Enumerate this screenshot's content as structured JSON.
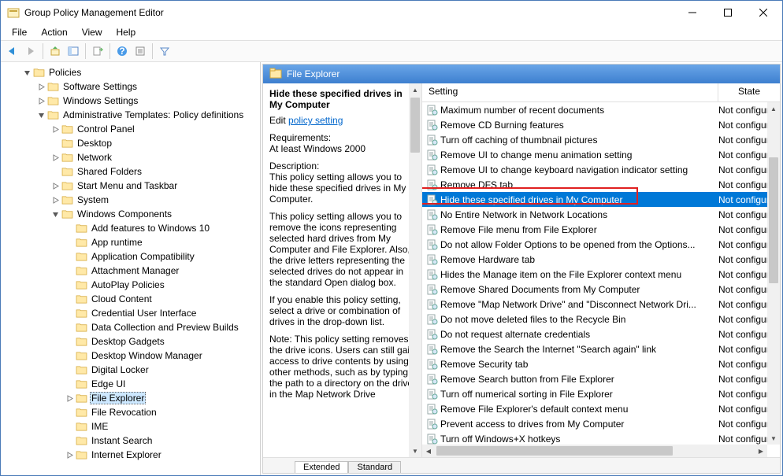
{
  "window": {
    "title": "Group Policy Management Editor"
  },
  "menus": [
    "File",
    "Action",
    "View",
    "Help"
  ],
  "tree": [
    {
      "indent": 1,
      "tw": "v",
      "label": "Policies"
    },
    {
      "indent": 2,
      "tw": ">",
      "label": "Software Settings"
    },
    {
      "indent": 2,
      "tw": ">",
      "label": "Windows Settings"
    },
    {
      "indent": 2,
      "tw": "v",
      "label": "Administrative Templates: Policy definitions"
    },
    {
      "indent": 3,
      "tw": ">",
      "label": "Control Panel"
    },
    {
      "indent": 3,
      "tw": "",
      "label": "Desktop"
    },
    {
      "indent": 3,
      "tw": ">",
      "label": "Network"
    },
    {
      "indent": 3,
      "tw": "",
      "label": "Shared Folders"
    },
    {
      "indent": 3,
      "tw": ">",
      "label": "Start Menu and Taskbar"
    },
    {
      "indent": 3,
      "tw": ">",
      "label": "System"
    },
    {
      "indent": 3,
      "tw": "v",
      "label": "Windows Components"
    },
    {
      "indent": 4,
      "tw": "",
      "label": "Add features to Windows 10"
    },
    {
      "indent": 4,
      "tw": "",
      "label": "App runtime"
    },
    {
      "indent": 4,
      "tw": "",
      "label": "Application Compatibility"
    },
    {
      "indent": 4,
      "tw": "",
      "label": "Attachment Manager"
    },
    {
      "indent": 4,
      "tw": "",
      "label": "AutoPlay Policies"
    },
    {
      "indent": 4,
      "tw": "",
      "label": "Cloud Content"
    },
    {
      "indent": 4,
      "tw": "",
      "label": "Credential User Interface"
    },
    {
      "indent": 4,
      "tw": "",
      "label": "Data Collection and Preview Builds"
    },
    {
      "indent": 4,
      "tw": "",
      "label": "Desktop Gadgets"
    },
    {
      "indent": 4,
      "tw": "",
      "label": "Desktop Window Manager"
    },
    {
      "indent": 4,
      "tw": "",
      "label": "Digital Locker"
    },
    {
      "indent": 4,
      "tw": "",
      "label": "Edge UI"
    },
    {
      "indent": 4,
      "tw": ">",
      "label": "File Explorer",
      "sel": true
    },
    {
      "indent": 4,
      "tw": "",
      "label": "File Revocation"
    },
    {
      "indent": 4,
      "tw": "",
      "label": "IME"
    },
    {
      "indent": 4,
      "tw": "",
      "label": "Instant Search"
    },
    {
      "indent": 4,
      "tw": ">",
      "label": "Internet Explorer"
    }
  ],
  "panel": {
    "title": "File Explorer",
    "selected_title": "Hide these specified drives in My Computer",
    "edit_prefix": "Edit ",
    "edit_link": "policy setting ",
    "req_label": "Requirements:",
    "req_text": "At least Windows 2000",
    "desc_label": "Description:",
    "desc_p1": "This policy setting allows you to hide these specified drives in My Computer.",
    "desc_p2": "This policy setting allows you to remove the icons representing selected hard drives from My Computer and File Explorer. Also, the drive letters representing the selected drives do not appear in the standard Open dialog box.",
    "desc_p3": "If you enable this policy setting, select a drive or combination of drives in the drop-down list.",
    "desc_p4": "Note: This policy setting removes the drive icons. Users can still gain access to drive contents by using other methods, such as by typing the path to a directory on the drive in the Map Network Drive"
  },
  "columns": {
    "setting": "Setting",
    "state": "State"
  },
  "rows": [
    {
      "label": "Maximum number of recent documents",
      "state": "Not configure"
    },
    {
      "label": "Remove CD Burning features",
      "state": "Not configure"
    },
    {
      "label": "Turn off caching of thumbnail pictures",
      "state": "Not configure"
    },
    {
      "label": "Remove UI to change menu animation setting",
      "state": "Not configure"
    },
    {
      "label": "Remove UI to change keyboard navigation indicator setting",
      "state": "Not configure"
    },
    {
      "label": "Remove DFS tab",
      "state": "Not configure"
    },
    {
      "label": "Hide these specified drives in My Computer",
      "state": "Not configure",
      "sel": true
    },
    {
      "label": "No Entire Network in Network Locations",
      "state": "Not configure"
    },
    {
      "label": "Remove File menu from File Explorer",
      "state": "Not configure"
    },
    {
      "label": "Do not allow Folder Options to be opened from the Options...",
      "state": "Not configure"
    },
    {
      "label": "Remove Hardware tab",
      "state": "Not configure"
    },
    {
      "label": "Hides the Manage item on the File Explorer context menu",
      "state": "Not configure"
    },
    {
      "label": "Remove Shared Documents from My Computer",
      "state": "Not configure"
    },
    {
      "label": "Remove \"Map Network Drive\" and \"Disconnect Network Dri...",
      "state": "Not configure"
    },
    {
      "label": "Do not move deleted files to the Recycle Bin",
      "state": "Not configure"
    },
    {
      "label": "Do not request alternate credentials",
      "state": "Not configure"
    },
    {
      "label": "Remove the Search the Internet \"Search again\" link",
      "state": "Not configure"
    },
    {
      "label": "Remove Security tab",
      "state": "Not configure"
    },
    {
      "label": "Remove Search button from File Explorer",
      "state": "Not configure"
    },
    {
      "label": "Turn off numerical sorting in File Explorer",
      "state": "Not configure"
    },
    {
      "label": "Remove File Explorer's default context menu",
      "state": "Not configure"
    },
    {
      "label": "Prevent access to drives from My Computer",
      "state": "Not configure"
    },
    {
      "label": "Turn off Windows+X hotkeys",
      "state": "Not configure"
    }
  ],
  "tabs": {
    "extended": "Extended",
    "standard": "Standard"
  }
}
